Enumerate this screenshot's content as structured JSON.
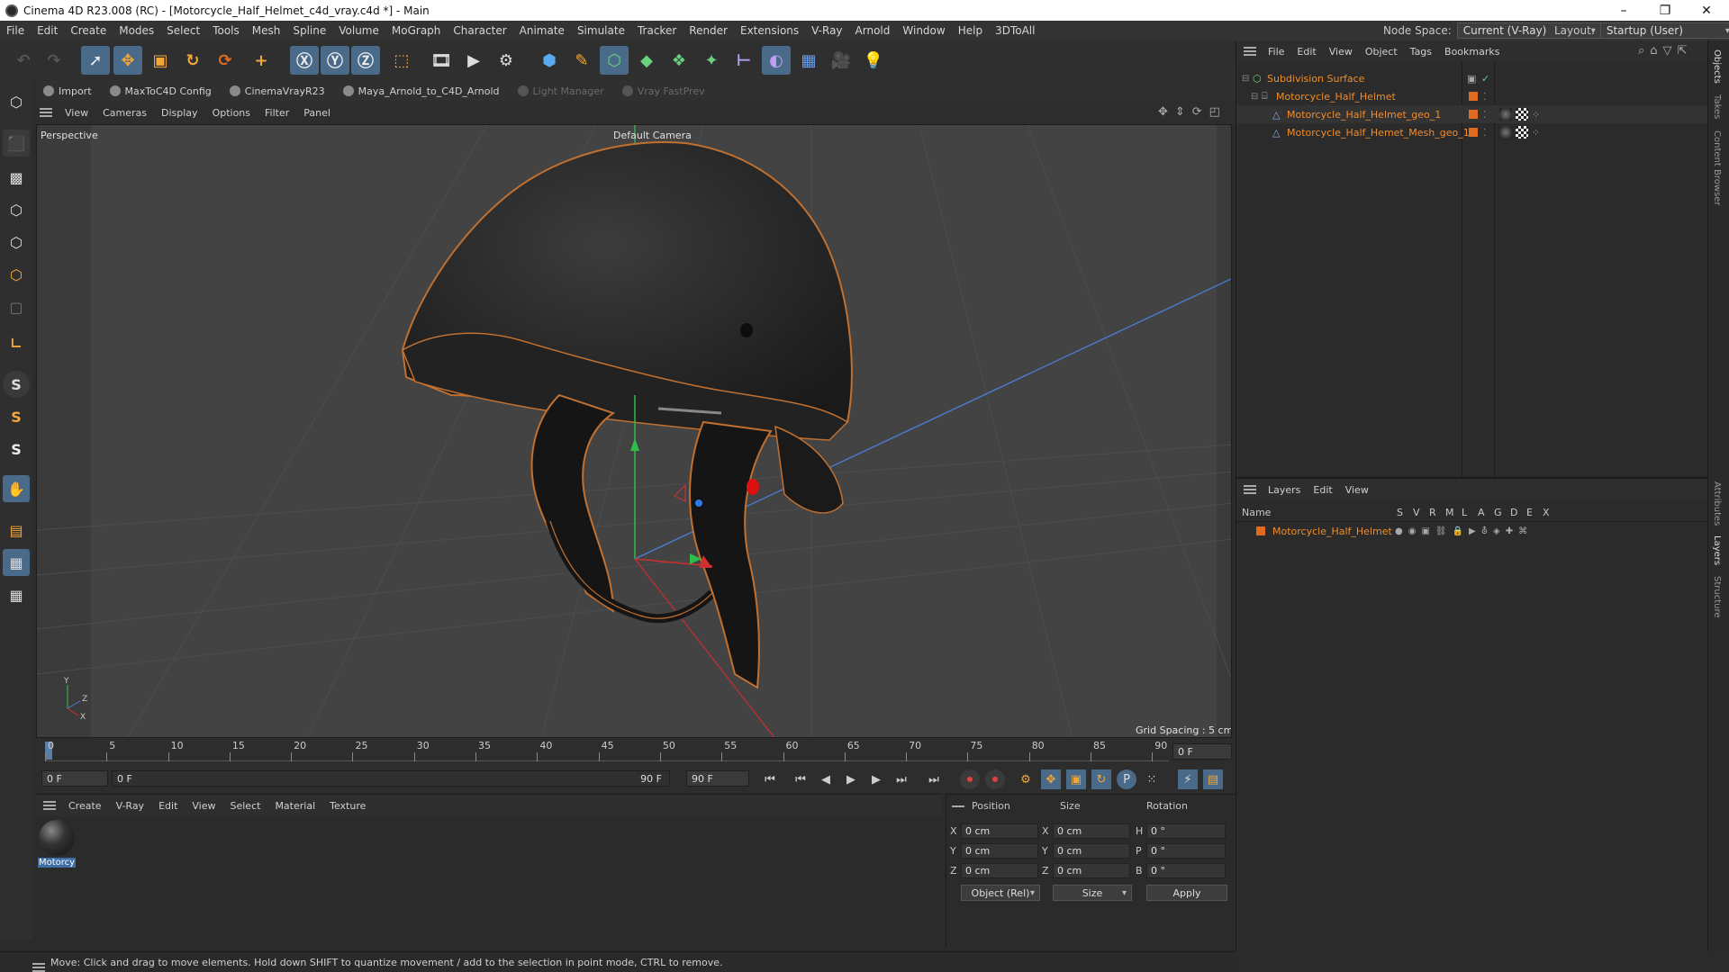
{
  "window": {
    "title": "Cinema 4D R23.008 (RC) - [Motorcycle_Half_Helmet_c4d_vray.c4d *] - Main",
    "minimize": "–",
    "maximize": "❐",
    "close": "✕"
  },
  "menu": [
    "File",
    "Edit",
    "Create",
    "Modes",
    "Select",
    "Tools",
    "Mesh",
    "Spline",
    "Volume",
    "MoGraph",
    "Character",
    "Animate",
    "Simulate",
    "Tracker",
    "Render",
    "Extensions",
    "V-Ray",
    "Arnold",
    "Window",
    "Help",
    "3DToAll"
  ],
  "node_space": {
    "label": "Node Space:",
    "value": "Current (V-Ray)"
  },
  "layout": {
    "label": "Layout:",
    "value": "Startup (User)"
  },
  "plugins": [
    {
      "label": "Import",
      "enabled": true
    },
    {
      "label": "MaxToC4D Config",
      "enabled": true
    },
    {
      "label": "CinemaVrayR23",
      "enabled": true
    },
    {
      "label": "Maya_Arnold_to_C4D_Arnold",
      "enabled": true
    },
    {
      "label": "Light Manager",
      "enabled": false
    },
    {
      "label": "Vray FastPrev",
      "enabled": false
    }
  ],
  "viewport_menu": [
    "View",
    "Cameras",
    "Display",
    "Options",
    "Filter",
    "Panel"
  ],
  "viewport": {
    "name": "Perspective",
    "camera": "Default Camera",
    "grid_spacing": "Grid Spacing : 5 cm",
    "axis_y": "Y",
    "axis_z": "Z",
    "axis_x": "X"
  },
  "timeline": {
    "ticks": [
      "0",
      "5",
      "10",
      "15",
      "20",
      "25",
      "30",
      "35",
      "40",
      "45",
      "50",
      "55",
      "60",
      "65",
      "70",
      "75",
      "80",
      "85",
      "90"
    ],
    "current_frame": "0 F"
  },
  "transport": {
    "start": "0 F",
    "range_start": "0 F",
    "range_end": "90 F",
    "end": "90 F"
  },
  "material_menu": [
    "Create",
    "V-Ray",
    "Edit",
    "View",
    "Select",
    "Material",
    "Texture"
  ],
  "material": {
    "name": "Motorcy"
  },
  "coords": {
    "headers": [
      "Position",
      "Size",
      "Rotation"
    ],
    "rows": [
      {
        "axis": "X",
        "pos": "0 cm",
        "saxis": "X",
        "size": "0 cm",
        "raxis": "H",
        "rot": "0 °"
      },
      {
        "axis": "Y",
        "pos": "0 cm",
        "saxis": "Y",
        "size": "0 cm",
        "raxis": "P",
        "rot": "0 °"
      },
      {
        "axis": "Z",
        "pos": "0 cm",
        "saxis": "Z",
        "size": "0 cm",
        "raxis": "B",
        "rot": "0 °"
      }
    ],
    "mode": "Object (Rel)",
    "size_mode": "Size",
    "apply": "Apply"
  },
  "status": "Move: Click and drag to move elements. Hold down SHIFT to quantize movement / add to the selection in point mode, CTRL to remove.",
  "object_menu": [
    "File",
    "Edit",
    "View",
    "Object",
    "Tags",
    "Bookmarks"
  ],
  "objects": [
    {
      "name": "Subdivision Surface",
      "level": 0
    },
    {
      "name": "Motorcycle_Half_Helmet",
      "level": 1
    },
    {
      "name": "Motorcycle_Half_Helmet_geo_1",
      "level": 2
    },
    {
      "name": "Motorcycle_Half_Hemet_Mesh_geo_1",
      "level": 2
    }
  ],
  "layer_menu": [
    "Layers",
    "Edit",
    "View"
  ],
  "layer_headers": {
    "name": "Name",
    "cols": [
      "S",
      "V",
      "R",
      "M",
      "L",
      "A",
      "G",
      "D",
      "E",
      "X"
    ]
  },
  "layers": [
    {
      "name": "Motorcycle_Half_Helmet"
    }
  ],
  "side_tabs": [
    "Objects",
    "Takes",
    "Content Browser",
    "Attributes",
    "Layers",
    "Structure"
  ],
  "colors": {
    "accent_orange": "#f08c2a",
    "selection_blue": "#4a6a8a",
    "layer_color": "#e06a20"
  }
}
